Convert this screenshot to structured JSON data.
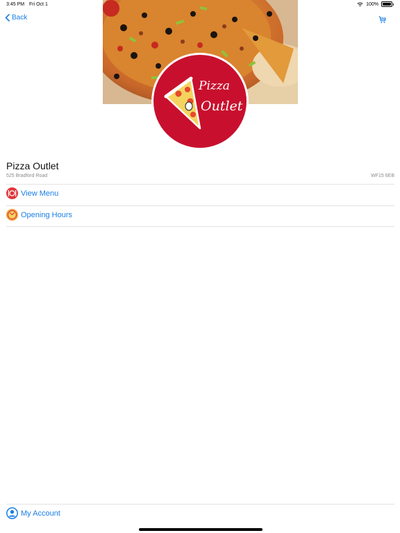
{
  "status": {
    "time": "3:45 PM",
    "date": "Fri Oct 1",
    "battery": "100%"
  },
  "nav": {
    "back_label": "Back"
  },
  "brand": {
    "logo_text_line1": "Pizza",
    "logo_text_line2": "Outlet",
    "accent_color": "#c8102e",
    "link_color": "#1a7ee6"
  },
  "store": {
    "name": "Pizza Outlet",
    "address": "525 Bradford Road",
    "postcode": "WF15 6EB"
  },
  "menu": {
    "items": [
      {
        "label": "View Menu",
        "icon": "plate-cutlery-icon"
      },
      {
        "label": "Opening Hours",
        "icon": "clock-icon"
      }
    ]
  },
  "footer": {
    "account_label": "My Account",
    "account_icon": "user-circle-icon"
  }
}
